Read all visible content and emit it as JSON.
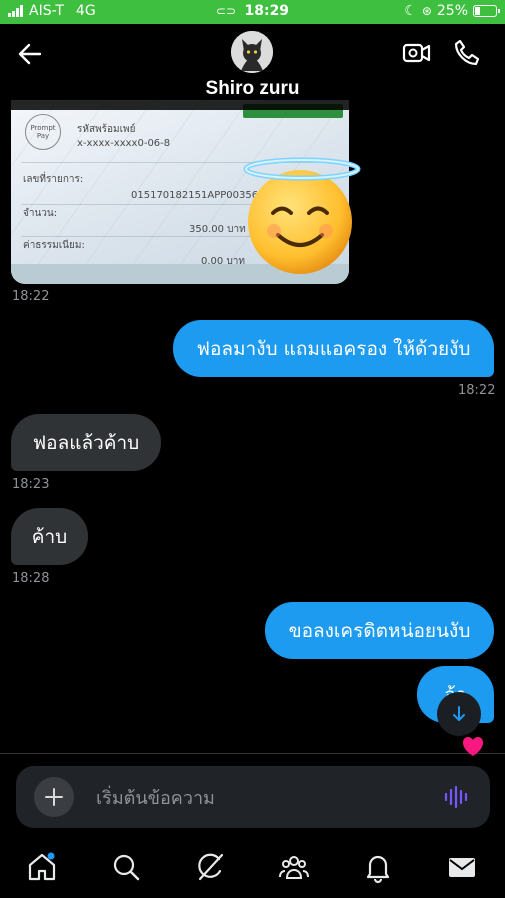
{
  "status_bar": {
    "carrier": "AIS-T",
    "network": "4G",
    "time": "18:29",
    "battery": "25%",
    "battery_level": 0.25
  },
  "header": {
    "contact_name": "Shiro zuru"
  },
  "receipt": {
    "logo_text": "Prompt Pay",
    "promptpay_label": "รหัสพร้อมเพย์",
    "promptpay_id": "x-xxxx-xxxx0-06-8",
    "ref_label": "เลขที่รายการ:",
    "ref_value": "015170182151APP00356",
    "amount_label": "จำนวน:",
    "amount_value": "350.00 บาท",
    "fee_label": "ค่าธรรมเนียม:",
    "fee_value": "0.00 บาท"
  },
  "messages": [
    {
      "direction": "in",
      "type": "image",
      "time": "18:22"
    },
    {
      "direction": "out",
      "text": "ฟอลมางับ แถมแอครอง ให้ด้วยงับ",
      "time": "18:22"
    },
    {
      "direction": "in",
      "text": "ฟอลแล้วค้าบ",
      "time": "18:23"
    },
    {
      "direction": "in",
      "text": "ค้าบ",
      "time": "18:28"
    },
    {
      "direction": "out",
      "text": "ขอลงเครดิตหน่อยนงับ"
    },
    {
      "direction": "out",
      "text": "จ้า",
      "reaction": "heart"
    }
  ],
  "composer": {
    "placeholder": "เริ่มต้นข้อความ"
  },
  "colors": {
    "accent": "#1d9bf0",
    "status_bar": "#3fbf3f",
    "incoming_bubble": "#2f3336",
    "voice_icon": "#7856ff",
    "heart": "#f91880"
  },
  "icons": {
    "back": "arrow-left-icon",
    "video": "video-camera-icon",
    "call": "phone-icon",
    "scroll": "arrow-down-icon",
    "add": "plus-icon",
    "voice": "voice-wave-icon",
    "nav": [
      "home-icon",
      "search-icon",
      "grok-icon",
      "communities-icon",
      "bell-icon",
      "mail-icon"
    ]
  }
}
